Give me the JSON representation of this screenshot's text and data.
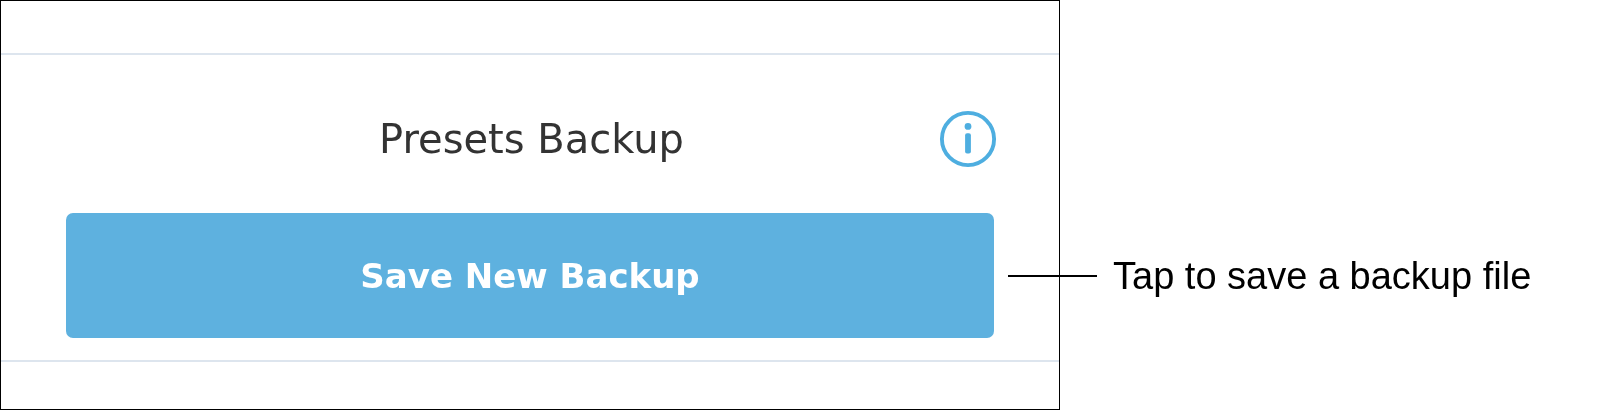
{
  "panel": {
    "title": "Presets Backup",
    "button": "Save New Backup"
  },
  "annotation": {
    "text": "Tap to save a backup file"
  }
}
